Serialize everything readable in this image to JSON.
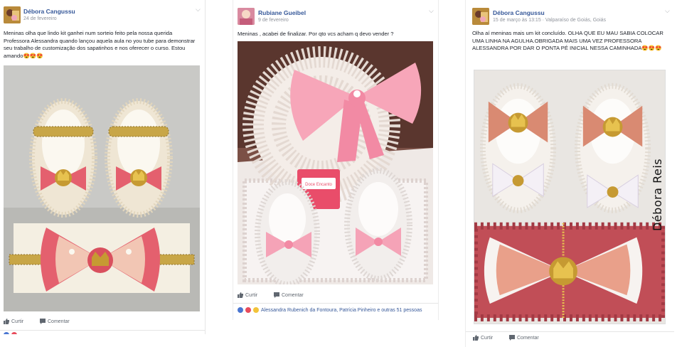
{
  "posts": [
    {
      "author": "Débora Cangussu",
      "date": "24 de fevereiro",
      "text": "Meninas olha que lindo kit ganhei num sorteio feito pela nossa querida Professora Alessandra quando lançou aquela aula no you tube para demonstrar seu trabalho de customização dos sapatinhos e nos oferecer o curso. Estou amando😍😍😍",
      "like_label": "Curtir",
      "comment_label": "Comentar"
    },
    {
      "author": "Rubiane Gueibel",
      "date": "9 de fevereiro",
      "text": "Meninas , acabei de finalizar. Por qto vcs acham q devo vender ?",
      "like_label": "Curtir",
      "comment_label": "Comentar",
      "reactions_text": "Alessandra Rubenich da Fontoura, Patrícia Pinheiro e outras 51 pessoas",
      "card_text": "Doce Encanto"
    },
    {
      "author": "Débora Cangussu",
      "date": "15 de março às 13:15 · Valparaíso de Goiás, Goiás",
      "text": "Olha aí meninas mais um kit concluído. OLHA QUE EU MAU SABIA COLOCAR UMA LINHA NA AGULHA.OBRIGADA MAIS UMA VEZ PROFESSORA ALESSANDRA POR DAR O PONTA PÉ INICIAL NESSA CAMINHADA😍😍😍",
      "watermark": "Débora Reis",
      "like_label": "Curtir",
      "comment_label": "Comentar"
    }
  ],
  "colors": {
    "author_link": "#365899",
    "meta_gray": "#90949c",
    "pink": "#f08aa6",
    "coral": "#e4606e",
    "pearl": "#f3ece0"
  },
  "icons": [
    "thumbs-up-icon",
    "comment-icon",
    "chevron-down-icon",
    "like-reaction-icon",
    "love-reaction-icon",
    "wow-reaction-icon"
  ]
}
